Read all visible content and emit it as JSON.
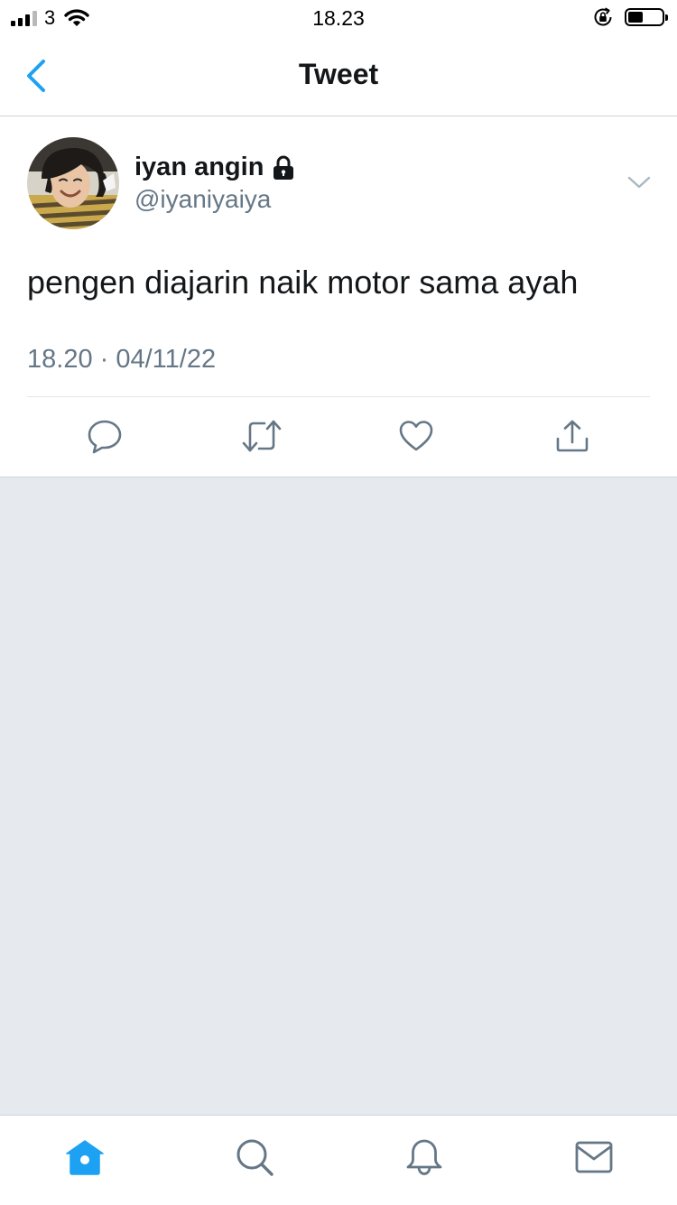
{
  "status_bar": {
    "carrier": "3",
    "time": "18.23",
    "battery_level": 0.45
  },
  "nav": {
    "title": "Tweet"
  },
  "tweet": {
    "author": {
      "name": "iyan angin",
      "handle": "@iyaniyaiya",
      "protected": true
    },
    "text": "pengen diajarin naik motor sama ayah",
    "meta": "18.20 · 04/11/22"
  },
  "actions": [
    "reply-icon",
    "retweet-icon",
    "like-icon",
    "share-icon"
  ],
  "tabs": [
    {
      "name": "home",
      "icon": "home-icon",
      "active": true
    },
    {
      "name": "search",
      "icon": "search-icon",
      "active": false
    },
    {
      "name": "notifications",
      "icon": "bell-icon",
      "active": false
    },
    {
      "name": "messages",
      "icon": "mail-icon",
      "active": false
    }
  ],
  "colors": {
    "accent": "#1da1f2",
    "icon_gray": "#657786",
    "text": "#14171a",
    "divider": "#ccd6dd",
    "page_background": "#e6eaef"
  }
}
